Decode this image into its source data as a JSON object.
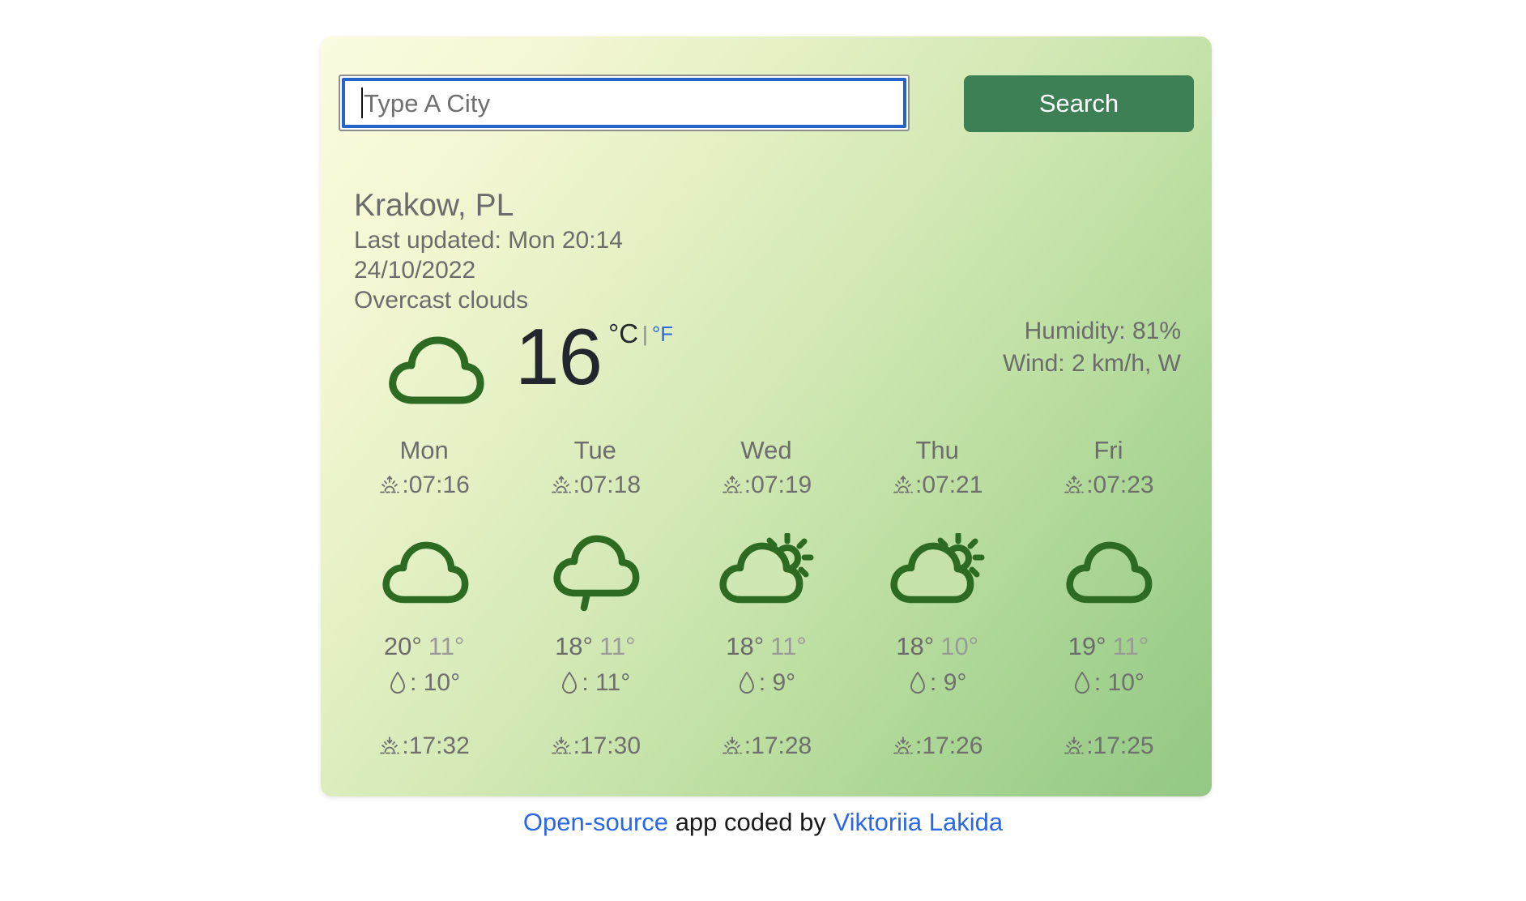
{
  "search": {
    "placeholder": "Type A City",
    "value": "",
    "button_label": "Search"
  },
  "current": {
    "city": "Krakow, PL",
    "last_updated": "Last updated: Mon 20:14",
    "date": "24/10/2022",
    "description": "Overcast clouds",
    "temperature": "16",
    "unit_celsius": "°C",
    "unit_separator": "|",
    "unit_fahrenheit": "°F",
    "humidity": "Humidity: 81%",
    "wind": "Wind: 2 km/h, W",
    "icon": "overcast-cloud-icon"
  },
  "forecast": [
    {
      "day": "Mon",
      "sunrise": ":07:16",
      "icon": "overcast-cloud-icon",
      "temp_max": "20°",
      "temp_min": "11°",
      "rain": ": 10°",
      "sunset": ":17:32"
    },
    {
      "day": "Tue",
      "sunrise": ":07:18",
      "icon": "rain-cloud-icon",
      "temp_max": "18°",
      "temp_min": "11°",
      "rain": ": 11°",
      "sunset": ":17:30"
    },
    {
      "day": "Wed",
      "sunrise": ":07:19",
      "icon": "sun-behind-cloud-icon",
      "temp_max": "18°",
      "temp_min": "11°",
      "rain": ": 9°",
      "sunset": ":17:28"
    },
    {
      "day": "Thu",
      "sunrise": ":07:21",
      "icon": "sun-behind-cloud-icon",
      "temp_max": "18°",
      "temp_min": "10°",
      "rain": ": 9°",
      "sunset": ":17:26"
    },
    {
      "day": "Fri",
      "sunrise": ":07:23",
      "icon": "overcast-cloud-icon",
      "temp_max": "19°",
      "temp_min": "11°",
      "rain": ": 10°",
      "sunset": ":17:25"
    }
  ],
  "footer": {
    "link_source": "Open-source",
    "middle_text": "app coded by",
    "link_author": "Viktoriia Lakida"
  },
  "colors": {
    "button_green": "#3d8055",
    "icon_green": "#2d6b22",
    "link_blue": "#2a68e8",
    "focus_blue": "#2563c9",
    "text_gray": "#6c6c6c",
    "temp_dark": "#22272e"
  }
}
